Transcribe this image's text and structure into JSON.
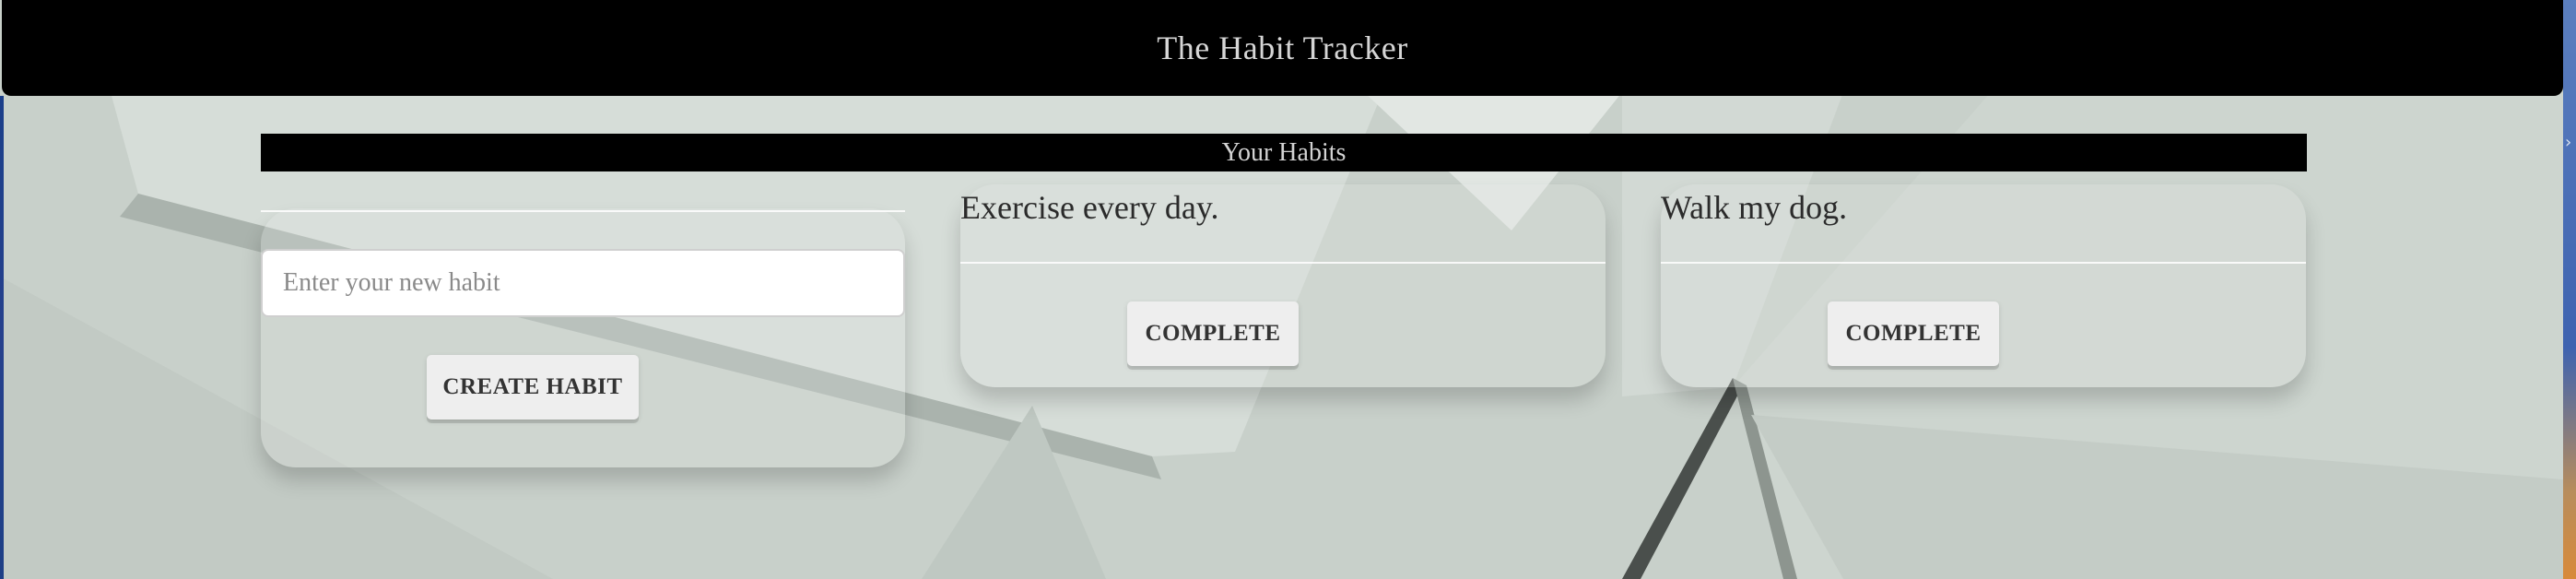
{
  "header": {
    "title": "The Habit Tracker"
  },
  "section": {
    "title": "Your Habits"
  },
  "new_habit": {
    "input_value": "",
    "input_placeholder": "Enter your new habit",
    "create_label": "CREATE HABIT"
  },
  "habits": [
    {
      "name": "Exercise every day.",
      "action_label": "COMPLETE"
    },
    {
      "name": "Walk my dog.",
      "action_label": "COMPLETE"
    }
  ],
  "colors": {
    "header_bg": "#000000",
    "section_bar_bg": "#000000",
    "page_bg": "#c9d1cb",
    "button_bg": "#eeeeee"
  }
}
